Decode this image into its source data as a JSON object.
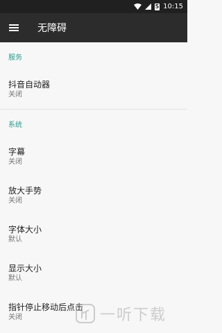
{
  "status_bar": {
    "time": "10:15",
    "battery": "5"
  },
  "app_bar": {
    "title": "无障碍"
  },
  "sections": [
    {
      "header": "服务",
      "items": [
        {
          "title": "抖音自动器",
          "subtitle": "关闭"
        }
      ]
    },
    {
      "header": "系统",
      "items": [
        {
          "title": "字幕",
          "subtitle": "关闭"
        },
        {
          "title": "放大手势",
          "subtitle": "关闭"
        },
        {
          "title": "字体大小",
          "subtitle": "默认"
        },
        {
          "title": "显示大小",
          "subtitle": "默认"
        },
        {
          "title": "指针停止移动后点击",
          "subtitle": "关闭"
        }
      ]
    }
  ],
  "watermark": {
    "text": "一听下载"
  },
  "colors": {
    "accent": "#2e9a8e",
    "app_bar": "#2c2c2c",
    "status_bar": "#202020",
    "background": "#f7f7f7"
  }
}
